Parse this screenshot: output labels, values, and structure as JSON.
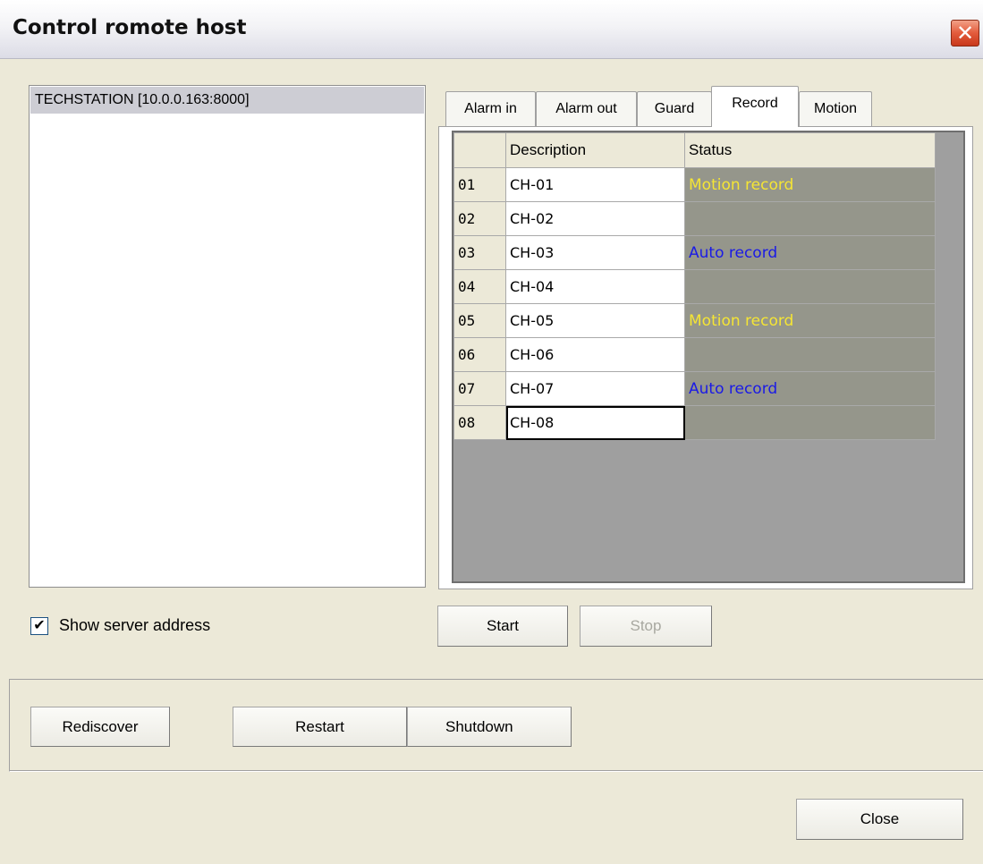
{
  "window": {
    "title": "Control romote host",
    "close_glyph": "✕"
  },
  "server_list": {
    "items": [
      "TECHSTATION [10.0.0.163:8000]"
    ]
  },
  "tabs": [
    {
      "label": "Alarm in",
      "active": false
    },
    {
      "label": "Alarm out",
      "active": false
    },
    {
      "label": "Guard",
      "active": false
    },
    {
      "label": "Record",
      "active": true
    },
    {
      "label": "Motion",
      "active": false
    }
  ],
  "grid": {
    "headers": [
      "",
      "Description",
      "Status"
    ],
    "rows": [
      {
        "num": "01",
        "description": "CH-01",
        "status": "Motion record"
      },
      {
        "num": "02",
        "description": "CH-02",
        "status": ""
      },
      {
        "num": "03",
        "description": "CH-03",
        "status": "Auto record"
      },
      {
        "num": "04",
        "description": "CH-04",
        "status": ""
      },
      {
        "num": "05",
        "description": "CH-05",
        "status": "Motion record"
      },
      {
        "num": "06",
        "description": "CH-06",
        "status": ""
      },
      {
        "num": "07",
        "description": "CH-07",
        "status": "Auto record"
      },
      {
        "num": "08",
        "description": "CH-08",
        "status": ""
      }
    ]
  },
  "colors": {
    "motion_record": "#f5e534",
    "auto_record": "#1a1ae6"
  },
  "show_server_address": {
    "label": "Show server address",
    "checked": true,
    "check_glyph": "✔"
  },
  "actions": {
    "start": "Start",
    "stop": "Stop",
    "stop_enabled": false
  },
  "host_buttons": {
    "rediscover": "Rediscover",
    "restart": "Restart",
    "shutdown": "Shutdown"
  },
  "footer": {
    "close": "Close"
  }
}
